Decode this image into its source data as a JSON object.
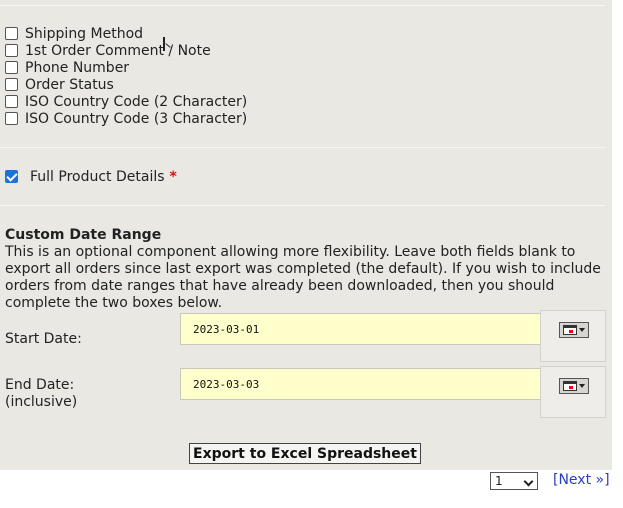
{
  "checkbox_options": [
    {
      "label": "Shipping Method",
      "checked": false
    },
    {
      "label": "1st Order Comment / Note",
      "checked": false
    },
    {
      "label": "Phone Number",
      "checked": false
    },
    {
      "label": "Order Status",
      "checked": false
    },
    {
      "label": "ISO Country Code (2 Character)",
      "checked": false
    },
    {
      "label": "ISO Country Code (3 Character)",
      "checked": false
    }
  ],
  "full_product": {
    "label": "Full Product Details",
    "required_marker": "*",
    "checked": true
  },
  "date_range": {
    "title": "Custom Date Range",
    "description": "This is an optional component allowing more flexibility. Leave both fields blank to export all orders since last export was completed (the default). If you wish to include orders from date ranges that have already been downloaded, then you should complete the two boxes below.",
    "start_label": "Start Date:",
    "start_value": "2023-03-01",
    "end_label": "End Date:",
    "end_note": "(inclusive)",
    "end_value": "2023-03-03"
  },
  "export_button": "Export to Excel Spreadsheet",
  "pager": {
    "selected_page": "1",
    "next_label": "[Next »]"
  },
  "colors": {
    "panel_bg": "#e9e8e3",
    "input_bg": "#ffffcc",
    "link": "#2b3fbd",
    "required": "#e01010"
  }
}
